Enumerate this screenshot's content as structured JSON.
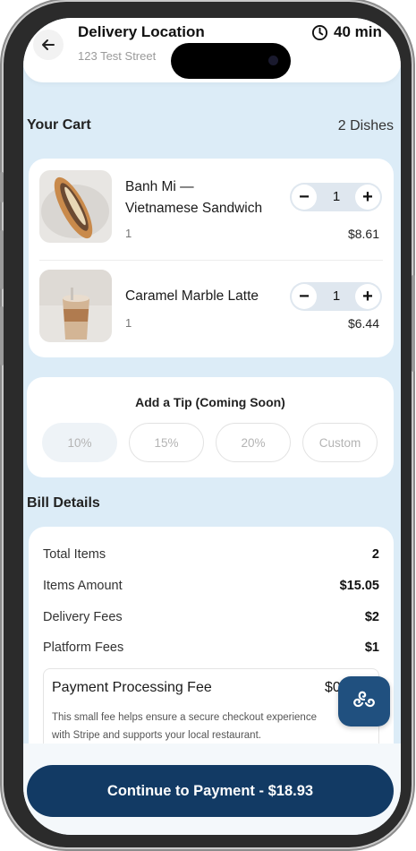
{
  "header": {
    "title": "Delivery Location",
    "address": "123 Test Street",
    "eta": "40 min"
  },
  "cart": {
    "title": "Your Cart",
    "count": "2 Dishes",
    "items": [
      {
        "name_line1": "Banh Mi —",
        "name_line2": "Vietnamese Sandwich",
        "quantity_text": "1",
        "stepper_value": "1",
        "price": "$8.61"
      },
      {
        "name_line1": "Caramel Marble Latte",
        "name_line2": "",
        "quantity_text": "1",
        "stepper_value": "1",
        "price": "$6.44"
      }
    ],
    "minus": "−",
    "plus": "+"
  },
  "tip": {
    "title": "Add a Tip (Coming Soon)",
    "options": [
      "10%",
      "15%",
      "20%",
      "Custom"
    ]
  },
  "bill": {
    "title": "Bill Details",
    "rows": [
      {
        "label": "Total Items",
        "value": "2"
      },
      {
        "label": "Items Amount",
        "value": "$15.05"
      },
      {
        "label": "Delivery Fees",
        "value": "$2"
      },
      {
        "label": "Platform Fees",
        "value": "$1"
      }
    ],
    "processing": {
      "title": "Payment Processing Fee",
      "value": "$0.93",
      "desc_line1": "This small fee helps ensure a secure checkout experience",
      "desc_line2": "with Stripe and supports your local restaurant."
    }
  },
  "cta": {
    "label": "Continue to Payment - $18.93"
  },
  "icons": {
    "back": "arrow-left-icon",
    "clock": "clock-icon",
    "fab": "triple-spiral-icon"
  },
  "colors": {
    "primary": "#123a64",
    "fab": "#20507f",
    "background": "#dcecf7"
  }
}
